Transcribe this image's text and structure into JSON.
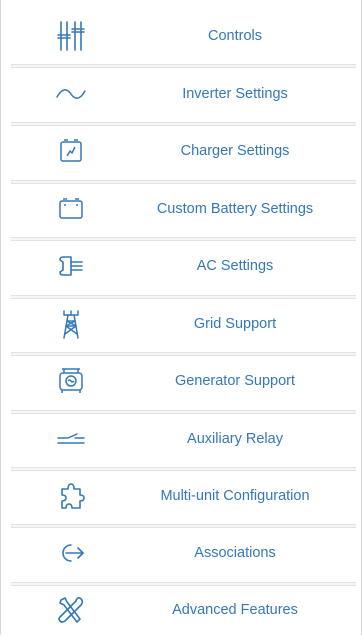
{
  "accent_color": "#3478b8",
  "menu": {
    "items": [
      {
        "label": "Controls",
        "icon": "sliders-icon"
      },
      {
        "label": "Inverter Settings",
        "icon": "sine-wave-icon"
      },
      {
        "label": "Charger Settings",
        "icon": "battery-charge-icon"
      },
      {
        "label": "Custom Battery Settings",
        "icon": "battery-icon"
      },
      {
        "label": "AC Settings",
        "icon": "ac-plug-icon"
      },
      {
        "label": "Grid Support",
        "icon": "grid-tower-icon"
      },
      {
        "label": "Generator Support",
        "icon": "generator-icon"
      },
      {
        "label": "Auxiliary Relay",
        "icon": "relay-icon"
      },
      {
        "label": "Multi-unit Configuration",
        "icon": "puzzle-icon"
      },
      {
        "label": "Associations",
        "icon": "association-arrow-icon"
      },
      {
        "label": "Advanced Features",
        "icon": "tools-icon"
      }
    ]
  }
}
